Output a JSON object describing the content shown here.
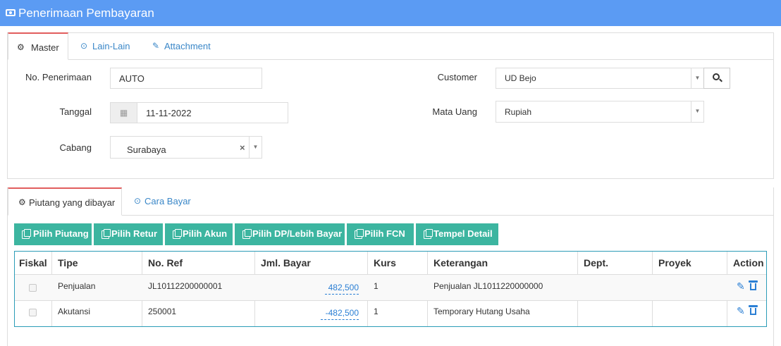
{
  "window": {
    "title": "Penerimaan Pembayaran",
    "icon": "money-icon"
  },
  "top_tabs": [
    {
      "label": "Master",
      "icon": "cogs-icon",
      "active": true
    },
    {
      "label": "Lain-Lain",
      "icon": "check-circle-icon",
      "active": false
    },
    {
      "label": "Attachment",
      "icon": "paperclip-icon",
      "active": false
    }
  ],
  "form": {
    "no_penerimaan": {
      "label": "No. Penerimaan",
      "value": "AUTO"
    },
    "tanggal": {
      "label": "Tanggal",
      "value": "11-11-2022",
      "icon": "calendar-icon"
    },
    "cabang": {
      "label": "Cabang",
      "value": "Surabaya",
      "clear": "×",
      "arrow": "▼"
    },
    "customer": {
      "label": "Customer",
      "value": "UD Bejo",
      "arrow": "▼",
      "search_icon": "search-icon"
    },
    "mata_uang": {
      "label": "Mata Uang",
      "value": "Rupiah",
      "arrow": "▼"
    }
  },
  "bottom_tabs": [
    {
      "label": "Piutang yang dibayar",
      "icon": "cogs-icon",
      "active": true
    },
    {
      "label": "Cara Bayar",
      "icon": "check-circle-icon",
      "active": false
    }
  ],
  "action_buttons": [
    {
      "label": "Pilih Piutang",
      "icon": "copy-icon"
    },
    {
      "label": "Pilih Retur",
      "icon": "copy-icon"
    },
    {
      "label": "Pilih Akun",
      "icon": "copy-icon"
    },
    {
      "label": "Pilih DP/Lebih Bayar",
      "icon": "copy-icon"
    },
    {
      "label": "Pilih FCN",
      "icon": "copy-icon"
    },
    {
      "label": "Tempel Detail",
      "icon": "paste-icon"
    }
  ],
  "table": {
    "headers": [
      "Fiskal",
      "Tipe",
      "No. Ref",
      "Jml. Bayar",
      "Kurs",
      "Keterangan",
      "Dept.",
      "Proyek",
      "Action"
    ],
    "rows": [
      {
        "fiskal": false,
        "tipe": "Penjualan",
        "no_ref": "JL10112200000001",
        "jml_bayar": "482,500",
        "kurs": "1",
        "keterangan": "Penjualan JL1011220000000",
        "dept": "",
        "proyek": ""
      },
      {
        "fiskal": false,
        "tipe": "Akutansi",
        "no_ref": "250001",
        "jml_bayar": "-482,500",
        "kurs": "1",
        "keterangan": "Temporary Hutang Usaha",
        "dept": "",
        "proyek": ""
      }
    ],
    "colors": {
      "border": "#2b9cb7",
      "link": "#2b7fd4"
    }
  },
  "colors": {
    "titlebar": "#5b9bf3",
    "button": "#3cb5a0",
    "tab_active_top": "#e15d5d",
    "tab_link": "#3a87c8"
  }
}
